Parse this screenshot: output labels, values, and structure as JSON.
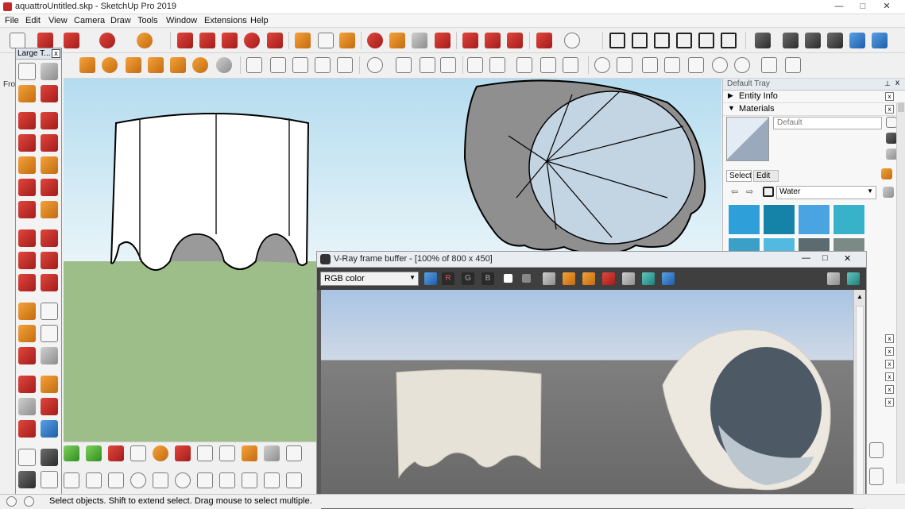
{
  "window": {
    "title": "aquattroUntitled.skp - SketchUp Pro 2019",
    "minimize": "—",
    "maximize": "□",
    "close": "✕"
  },
  "menu": [
    "File",
    "Edit",
    "View",
    "Camera",
    "Draw",
    "Tools",
    "Window",
    "Extensions",
    "Help"
  ],
  "large_tool_set": {
    "title": "Large T...",
    "close": "x"
  },
  "viewport": {
    "scene_tab": "Fro"
  },
  "default_tray": {
    "title": "Default Tray",
    "pin": "⊥",
    "close": "x",
    "entity_info": "Entity Info",
    "materials": "Materials",
    "material_name": "Default",
    "tab_select": "Select",
    "tab_edit": "Edit",
    "library": "Water",
    "swatch_colors": [
      "#2e9fd8",
      "#1583a7",
      "#4aa4e2",
      "#38b2c8",
      "#3aa0c8",
      "#52b9e0",
      "#5b6b6f",
      "#7c8a86"
    ]
  },
  "vray": {
    "title": "V-Ray frame buffer - [100% of 800 x 450]",
    "channel": "RGB color",
    "r": "R",
    "g": "G",
    "b": "B"
  },
  "status": {
    "message": "Select objects. Shift to extend select. Drag mouse to select multiple."
  }
}
